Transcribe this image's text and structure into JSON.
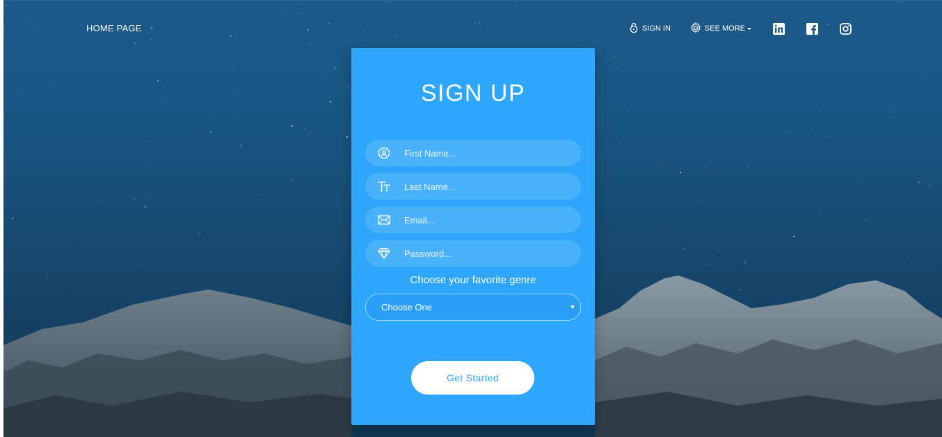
{
  "nav": {
    "home": "HOME PAGE",
    "sign_in": "SIGN IN",
    "see_more": "SEE MORE"
  },
  "icons": {
    "sign_in": "lock-icon",
    "see_more": "gear-icon",
    "social": [
      "linkedin-icon",
      "facebook-icon",
      "instagram-icon"
    ]
  },
  "form": {
    "title": "SIGN UP",
    "fields": [
      {
        "icon": "user-icon",
        "placeholder": "First Name..."
      },
      {
        "icon": "text-icon",
        "placeholder": "Last Name..."
      },
      {
        "icon": "mail-icon",
        "placeholder": "Email..."
      },
      {
        "icon": "diamond-icon",
        "placeholder": "Password..."
      }
    ],
    "genre_label": "Choose your favorite genre",
    "genre_select": "Choose One",
    "submit": "Get Started"
  },
  "colors": {
    "card": "#2ea6fb",
    "field": "#4ab2fb",
    "button_text": "#2ea6fb",
    "sky": "#1a5683"
  }
}
